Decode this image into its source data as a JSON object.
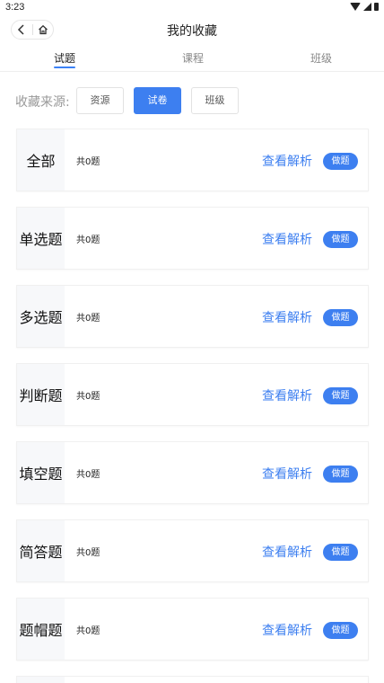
{
  "status_bar": {
    "time": "3:23"
  },
  "nav": {
    "title": "我的收藏"
  },
  "tabs": [
    {
      "label": "试题",
      "active": true
    },
    {
      "label": "课程",
      "active": false
    },
    {
      "label": "班级",
      "active": false
    }
  ],
  "filter": {
    "label": "收藏来源:",
    "options": [
      {
        "label": "资源",
        "active": false
      },
      {
        "label": "试卷",
        "active": true
      },
      {
        "label": "班级",
        "active": false
      }
    ]
  },
  "categories": [
    {
      "name": "全部",
      "count": "共0题",
      "view_label": "查看解析",
      "do_label": "做题"
    },
    {
      "name": "单选题",
      "count": "共0题",
      "view_label": "查看解析",
      "do_label": "做题"
    },
    {
      "name": "多选题",
      "count": "共0题",
      "view_label": "查看解析",
      "do_label": "做题"
    },
    {
      "name": "判断题",
      "count": "共0题",
      "view_label": "查看解析",
      "do_label": "做题"
    },
    {
      "name": "填空题",
      "count": "共0题",
      "view_label": "查看解析",
      "do_label": "做题"
    },
    {
      "name": "简答题",
      "count": "共0题",
      "view_label": "查看解析",
      "do_label": "做题"
    },
    {
      "name": "题帽题",
      "count": "共0题",
      "view_label": "查看解析",
      "do_label": "做题"
    }
  ],
  "colors": {
    "accent": "#3d7ff0",
    "muted": "#999999"
  },
  "icons": {
    "back": "chevron-left-icon",
    "home": "home-icon"
  }
}
